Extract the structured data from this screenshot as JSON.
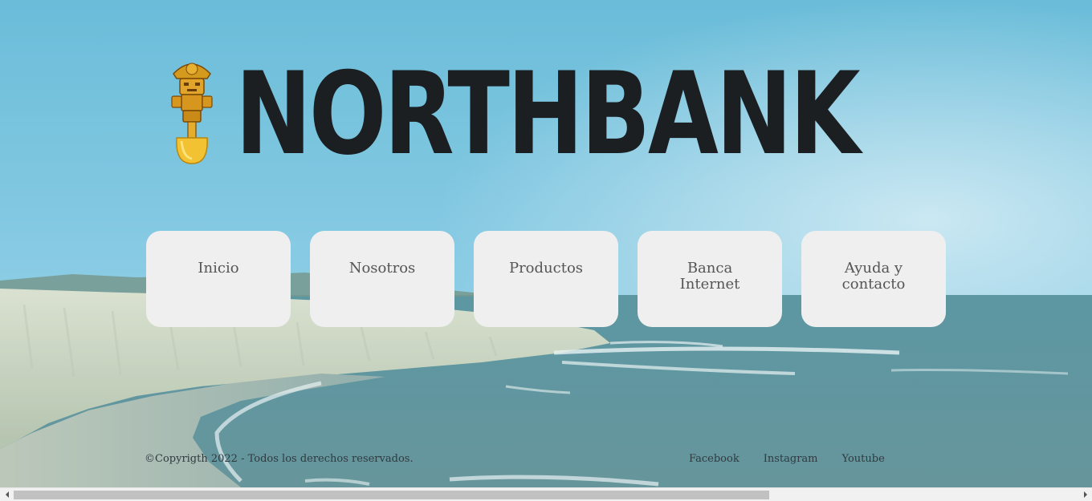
{
  "brand": {
    "name": "NORTHBANK",
    "logo_icon": "tumi-icon"
  },
  "nav": {
    "items": [
      {
        "label": "Inicio"
      },
      {
        "label": "Nosotros"
      },
      {
        "label": "Productos"
      },
      {
        "label": "Banca Internet"
      },
      {
        "label": "Ayuda y contacto"
      }
    ]
  },
  "footer": {
    "copyright": "©Copyrigth 2022 - Todos los derechos reservados.",
    "links": [
      {
        "label": "Facebook"
      },
      {
        "label": "Instagram"
      },
      {
        "label": "Youtube"
      }
    ]
  },
  "scrollbar": {
    "horizontal_thumb_fraction": 0.71
  },
  "colors": {
    "card_bg": "#efefef",
    "brand_text": "#1b1f22",
    "nav_text": "#555555"
  }
}
